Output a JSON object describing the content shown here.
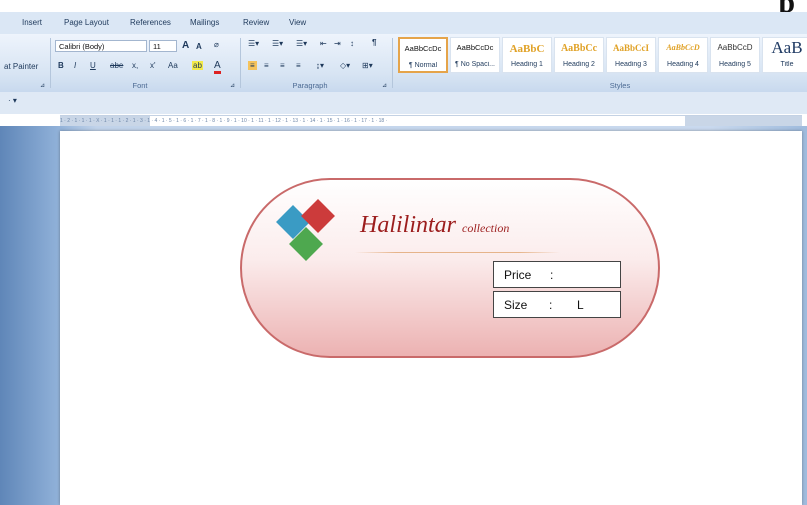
{
  "corner_title_glyph": "p",
  "ribbon": {
    "tabs": [
      "Insert",
      "Page Layout",
      "References",
      "Mailings",
      "Review",
      "View"
    ],
    "clipboard": {
      "format_painter": "at Painter"
    },
    "font": {
      "name": "Calibri (Body)",
      "size": "11",
      "grow": "A",
      "shrink": "A",
      "bold": "B",
      "italic": "I",
      "underline": "U",
      "strikethrough": "abe",
      "subscript": "x,",
      "superscript": "x'",
      "change_case": "Aa",
      "highlight": "ab",
      "font_color": "A",
      "group_label": "Font"
    },
    "paragraph": {
      "group_label": "Paragraph",
      "pilcrow": "¶"
    },
    "styles": {
      "group_label": "Styles",
      "items": [
        {
          "sample": "AaBbCcDc",
          "name": "¶ Normal",
          "selected": true,
          "color": "#111111"
        },
        {
          "sample": "AaBbCcDc",
          "name": "¶ No Spaci...",
          "selected": false,
          "color": "#111111"
        },
        {
          "sample": "AaBbC",
          "name": "Heading 1",
          "selected": false,
          "color": "#e0a125"
        },
        {
          "sample": "AaBbCc",
          "name": "Heading 2",
          "selected": false,
          "color": "#e0a125"
        },
        {
          "sample": "AaBbCcI",
          "name": "Heading 3",
          "selected": false,
          "color": "#e0a125"
        },
        {
          "sample": "AaBbCcD",
          "name": "Heading 4",
          "selected": false,
          "color": "#e0a125"
        },
        {
          "sample": "AaBbCcD",
          "name": "Heading 5",
          "selected": false,
          "color": "#333333"
        },
        {
          "sample": "AaB",
          "name": "Title",
          "selected": false,
          "color": "#1f3a63"
        }
      ]
    }
  },
  "ruler_text": "1 · 2 · 1 · 1 · 1 · X · 1 · 1 · 1 · 2 · 1 · 3 · 1 · 4 · 1 · 5 · 1 · 6 · 1 · 7 · 1 · 8 · 1 · 9 · 1 · 10 · 1 · 11 · 1 · 12 · 1 · 13 · 1 · 14 · 1 · 15 · 1 · 16 · 1 · 17 · 1 · 18 ·",
  "document": {
    "label": {
      "brand": "Halilintar",
      "brand_suffix": "collection",
      "price_label": "Price",
      "price_sep": ":",
      "size_label": "Size",
      "size_sep": ":",
      "size_value": "L"
    },
    "logo_colors": {
      "top": "#cc3b3b",
      "left": "#3a9bc4",
      "bottom": "#4ea84f"
    }
  }
}
